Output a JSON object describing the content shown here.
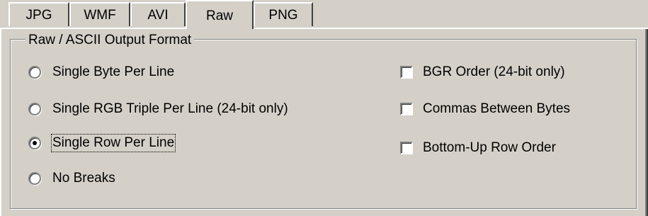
{
  "tabs": [
    {
      "label": "JPG"
    },
    {
      "label": "WMF"
    },
    {
      "label": "AVI"
    },
    {
      "label": "Raw",
      "active": true
    },
    {
      "label": "PNG"
    }
  ],
  "group": {
    "title": "Raw / ASCII Output Format",
    "radios": [
      {
        "label": "Single Byte Per Line",
        "checked": false
      },
      {
        "label": "Single RGB Triple Per Line (24-bit only)",
        "checked": false
      },
      {
        "label": "Single Row Per Line",
        "checked": true
      },
      {
        "label": "No Breaks",
        "checked": false
      }
    ],
    "checkboxes": [
      {
        "label": "BGR Order (24-bit only)",
        "checked": false
      },
      {
        "label": "Commas Between Bytes",
        "checked": false
      },
      {
        "label": "Bottom-Up Row Order",
        "checked": false
      }
    ]
  }
}
